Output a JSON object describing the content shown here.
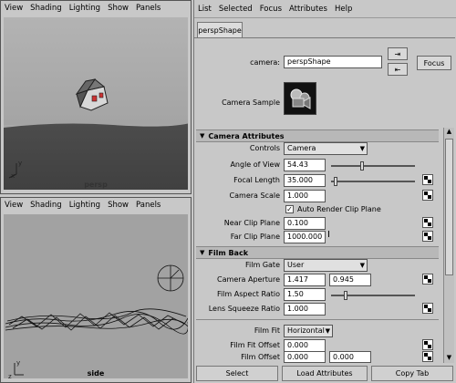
{
  "persp_panel": {
    "menu": [
      "View",
      "Shading",
      "Lighting",
      "Show",
      "Panels"
    ],
    "label": "persp",
    "axis_y": "y",
    "axis_x": "x"
  },
  "side_panel": {
    "menu": [
      "View",
      "Shading",
      "Lighting",
      "Show",
      "Panels"
    ],
    "label": "side",
    "axis_y": "y",
    "axis_z": "z"
  },
  "attribute_editor": {
    "menu": [
      "List",
      "Selected",
      "Focus",
      "Attributes",
      "Help"
    ],
    "tab": "perspShape",
    "camera_label": "camera:",
    "camera_value": "perspShape",
    "focus_button": "Focus",
    "camera_sample_label": "Camera Sample",
    "sections": {
      "camera_attributes": "Camera Attributes",
      "film_back": "Film Back"
    },
    "fields": {
      "controls_label": "Controls",
      "controls_value": "Camera",
      "angle_of_view_label": "Angle of View",
      "angle_of_view_value": "54.43",
      "focal_length_label": "Focal Length",
      "focal_length_value": "35.000",
      "camera_scale_label": "Camera Scale",
      "camera_scale_value": "1.000",
      "auto_render_clip_label": "Auto Render Clip Plane",
      "near_clip_label": "Near Clip Plane",
      "near_clip_value": "0.100",
      "far_clip_label": "Far Clip Plane",
      "far_clip_value": "1000.000",
      "film_gate_label": "Film Gate",
      "film_gate_value": "User",
      "camera_aperture_label": "Camera Aperture",
      "camera_aperture_value1": "1.417",
      "camera_aperture_value2": "0.945",
      "film_aspect_label": "Film Aspect Ratio",
      "film_aspect_value": "1.50",
      "lens_squeeze_label": "Lens Squeeze Ratio",
      "lens_squeeze_value": "1.000",
      "film_fit_label": "Film Fit",
      "film_fit_value": "Horizontal",
      "film_fit_offset_label": "Film Fit Offset",
      "film_fit_offset_value": "0.000",
      "film_offset_label": "Film Offset",
      "film_offset_value1": "0.000",
      "film_offset_value2": "0.000"
    },
    "bottom_buttons": {
      "select": "Select",
      "load": "Load Attributes",
      "copy": "Copy Tab"
    }
  }
}
